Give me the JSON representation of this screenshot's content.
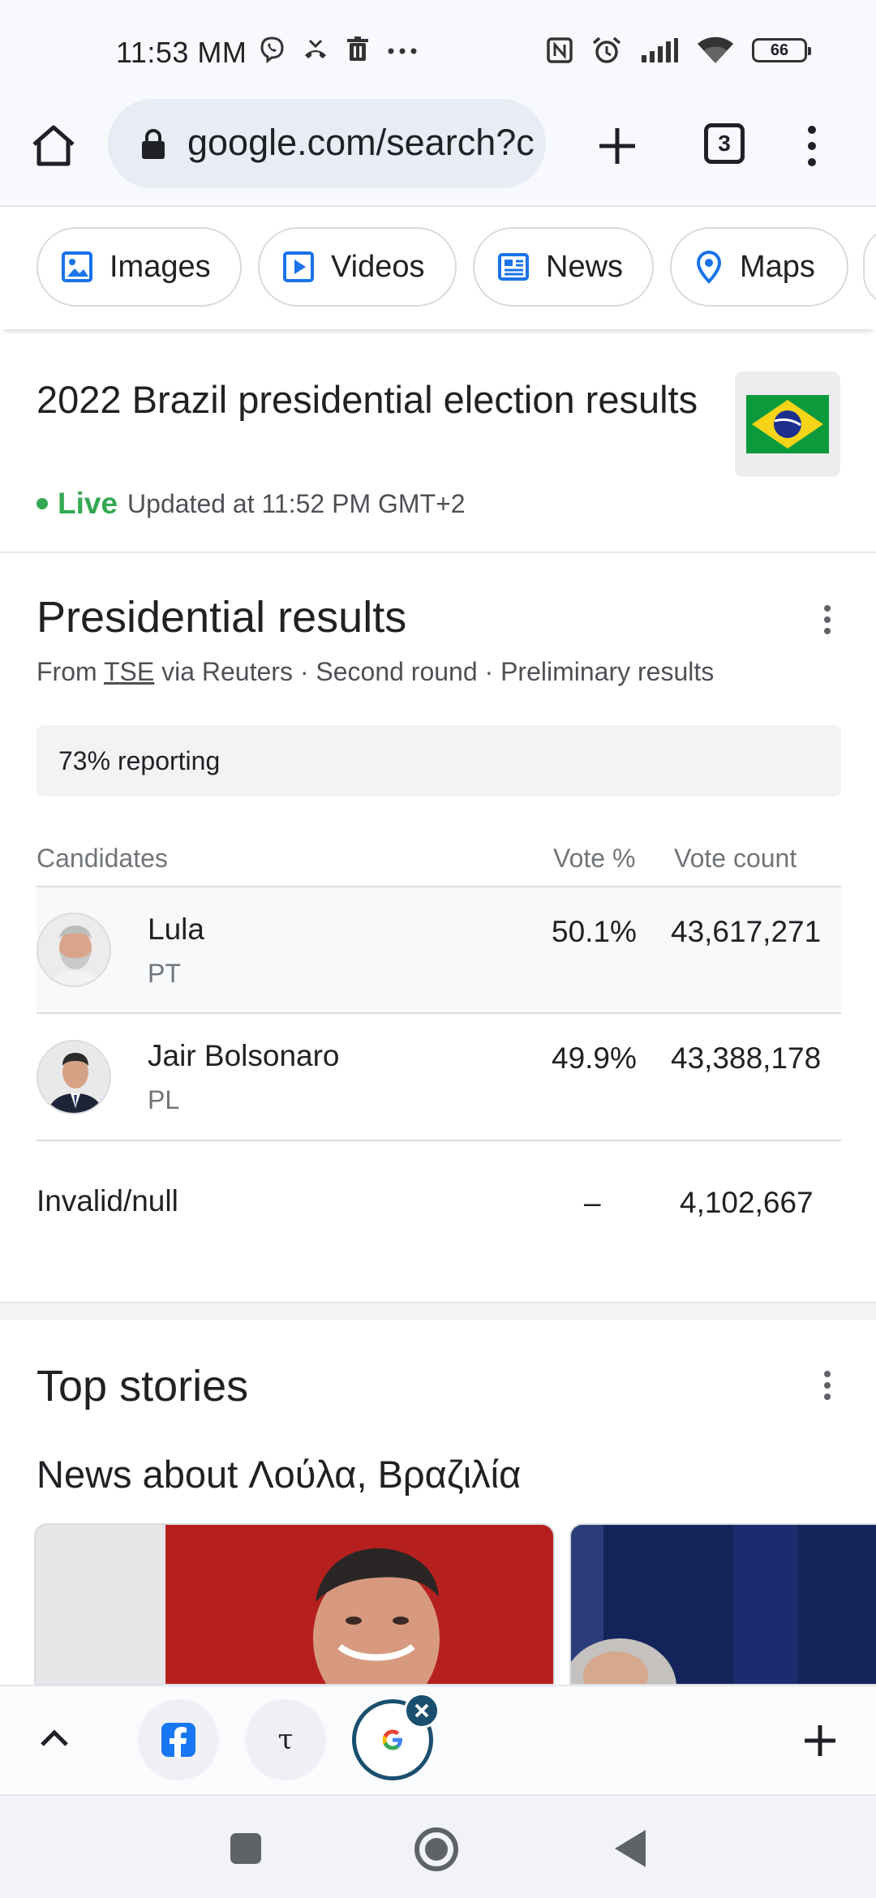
{
  "status_bar": {
    "time": "11:53 MM",
    "battery": "66"
  },
  "browser": {
    "url": "google.com/search?c",
    "tab_count": "3"
  },
  "chips": [
    {
      "label": "Images",
      "icon": "image-icon"
    },
    {
      "label": "Videos",
      "icon": "play-icon"
    },
    {
      "label": "News",
      "icon": "news-icon"
    },
    {
      "label": "Maps",
      "icon": "map-pin-icon"
    }
  ],
  "header": {
    "title": "2022 Brazil presidential election results",
    "live_label": "Live",
    "updated": "Updated at 11:52 PM GMT+2"
  },
  "results": {
    "title": "Presidential results",
    "source_prefix": "From ",
    "source_link": "TSE",
    "source_suffix": " via Reuters · Second round · Preliminary results",
    "reporting": "73% reporting",
    "columns": {
      "candidates": "Candidates",
      "vote_pct": "Vote %",
      "vote_count": "Vote count"
    },
    "rows": [
      {
        "name": "Lula",
        "party": "PT",
        "pct": "50.1%",
        "count": "43,617,271"
      },
      {
        "name": "Jair Bolsonaro",
        "party": "PL",
        "pct": "49.9%",
        "count": "43,388,178"
      }
    ],
    "invalid": {
      "label": "Invalid/null",
      "pct": "–",
      "count": "4,102,667"
    }
  },
  "top_stories": {
    "title": "Top stories",
    "news_about": "News about Λούλα, Βραζιλία"
  },
  "tab_strip": {
    "tabs": [
      "facebook-tab",
      "tau-tab",
      "google-tab"
    ],
    "tau_glyph": "τ",
    "active_glyph": "G"
  },
  "colors": {
    "live_green": "#34a853",
    "link_blue": "#1a73e8",
    "active_tab": "#1a4f6e"
  }
}
